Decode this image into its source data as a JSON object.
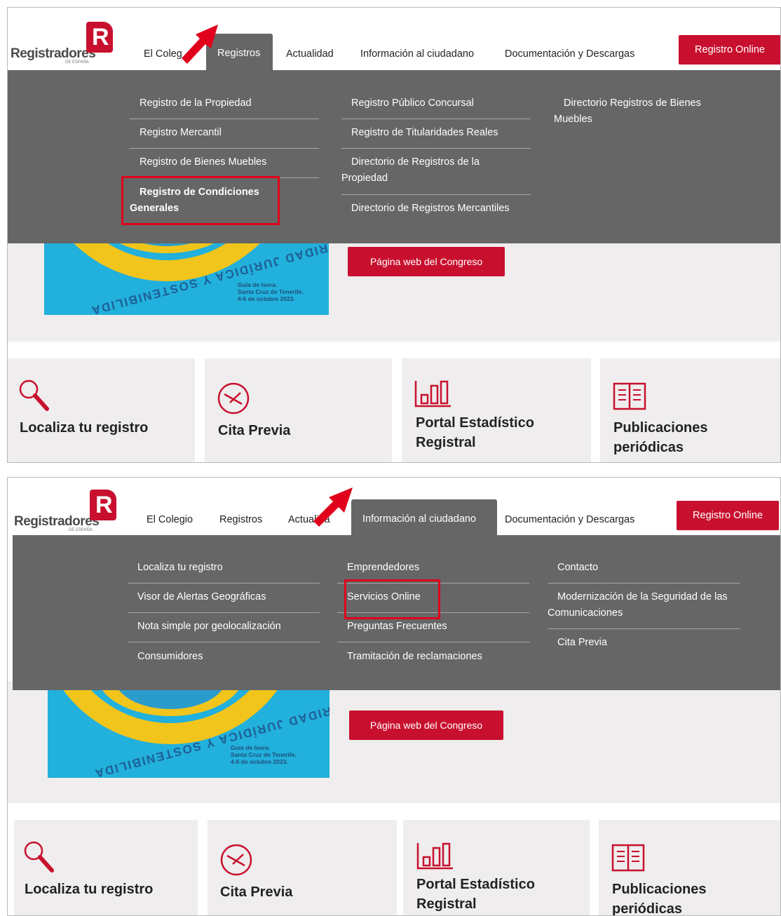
{
  "brand": {
    "name": "Registradores",
    "subtitle": "DE ESPAÑA",
    "mark": "R"
  },
  "nav": {
    "el_colegio": "El Colegio",
    "registros": "Registros",
    "actualidad": "Actualidad",
    "informacion": "Información al ciudadano",
    "documentacion": "Documentación y Descargas",
    "registro_online": "Registro Online"
  },
  "nav_cut": {
    "el_colegio": "El Coleg",
    "actualidad": "Actualida"
  },
  "registros_menu": {
    "col1": [
      "Registro de la Propiedad",
      "Registro Mercantil",
      "Registro de Bienes Muebles",
      "Registro de Condiciones Generales"
    ],
    "col2": [
      "Registro Público Concursal",
      "Registro de Titularidades Reales",
      "Directorio de Registros de la Propiedad",
      "Directorio de Registros Mercantiles"
    ],
    "col3": [
      "Directorio Registros de Bienes Muebles"
    ]
  },
  "informacion_menu": {
    "col1": [
      "Localiza tu registro",
      "Visor de Alertas Geográficas",
      "Nota simple por geolocalización",
      "Consumidores"
    ],
    "col2": [
      "Emprendedores",
      "Servicios Online",
      "Preguntas Frecuentes",
      "Tramitación de reclamaciones"
    ],
    "col3": [
      "Contacto",
      "Modernización de la Seguridad de las Comunicaciones",
      "Cita Previa"
    ]
  },
  "hero": {
    "poster_curved_text": "URIDAD JURÍDICA Y SOSTENIBILIDA",
    "poster_info": "Guía de Isora.\nSanta Cruz de Tenerife.\n4-6 de octubre 2023.",
    "congreso_button": "Página web del Congreso"
  },
  "cards": {
    "localiza": "Localiza tu registro",
    "cita": "Cita Previa",
    "portal": "Portal Estadístico Registral",
    "publicaciones": "Publicaciones periódicas"
  },
  "icons": [
    "magnifier-icon",
    "clock-icon",
    "bar-chart-icon",
    "book-icon",
    "arrow-icon"
  ],
  "colors": {
    "brand_red": "#c8102e",
    "menu_gray": "#666666",
    "hero_bg": "#efeded",
    "highlight_red": "#e0001b"
  }
}
